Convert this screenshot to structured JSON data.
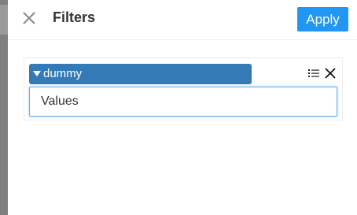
{
  "header": {
    "title": "Filters",
    "apply_label": "Apply"
  },
  "filter": {
    "field_name": "dummy",
    "values_text": "Values"
  },
  "colors": {
    "apply_bg": "#2196f3",
    "tag_bg": "#337ab7",
    "focus_border": "#66afe9"
  },
  "icons": {
    "close": "close-icon",
    "caret": "caret-down-icon",
    "list": "list-icon",
    "remove": "remove-icon"
  }
}
